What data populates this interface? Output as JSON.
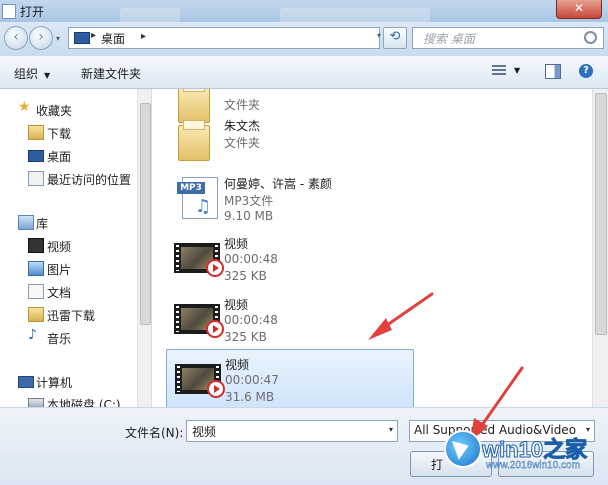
{
  "window": {
    "title": "打开",
    "close_glyph": "✕"
  },
  "address": {
    "back_glyph": "‹",
    "forward_glyph": "›",
    "separator": "▸",
    "crumb": "桌面",
    "crumb_arrow": "▸",
    "dropdown_glyph": "▾",
    "refresh_glyph": "⟲",
    "search_placeholder": "搜索 桌面"
  },
  "toolbar": {
    "organize_label": "组织",
    "organize_arrow": "▼",
    "new_folder_label": "新建文件夹",
    "views_arrow": "▼",
    "help_glyph": "?"
  },
  "nav": {
    "favorites_label": "收藏夹",
    "favorites": [
      {
        "label": "下载",
        "icon": "download-folder-icon"
      },
      {
        "label": "桌面",
        "icon": "desktop-icon"
      },
      {
        "label": "最近访问的位置",
        "icon": "recent-places-icon"
      }
    ],
    "libraries_label": "库",
    "libraries": [
      {
        "label": "视频",
        "icon": "video-library-icon"
      },
      {
        "label": "图片",
        "icon": "pictures-library-icon"
      },
      {
        "label": "文档",
        "icon": "documents-library-icon"
      },
      {
        "label": "迅雷下载",
        "icon": "thunder-download-icon"
      },
      {
        "label": "音乐",
        "icon": "music-library-icon"
      }
    ],
    "computer_label": "计算机",
    "drive_label": "本地磁盘 (C:)"
  },
  "files": [
    {
      "name": "",
      "type": "文件夹",
      "size": "",
      "kind": "folder"
    },
    {
      "name": "朱文杰",
      "type": "文件夹",
      "size": "",
      "kind": "folder"
    },
    {
      "name": "何曼婷、许嵩 - 素颜",
      "type": "MP3文件",
      "size": "9.10 MB",
      "kind": "mp3",
      "badge": "MP3",
      "note": "♫"
    },
    {
      "name": "视频",
      "type": "00:00:48",
      "size": "325 KB",
      "kind": "video"
    },
    {
      "name": "视频",
      "type": "00:00:48",
      "size": "325 KB",
      "kind": "video"
    },
    {
      "name": "视频",
      "type": "00:00:47",
      "size": "31.6 MB",
      "kind": "video",
      "selected": true
    }
  ],
  "bottom": {
    "filename_label": "文件名(N):",
    "filename_value": "视频",
    "filter_value": "All Supported Audio&Video",
    "dropdown_glyph": "▾",
    "open_label": "打"
  },
  "watermark": {
    "brand": "win10之家",
    "url": "www.2016win10.com"
  },
  "colors": {
    "accent": "#3a78c2",
    "selection": "#cfe4fb",
    "annotation_arrow": "#e0413c"
  }
}
